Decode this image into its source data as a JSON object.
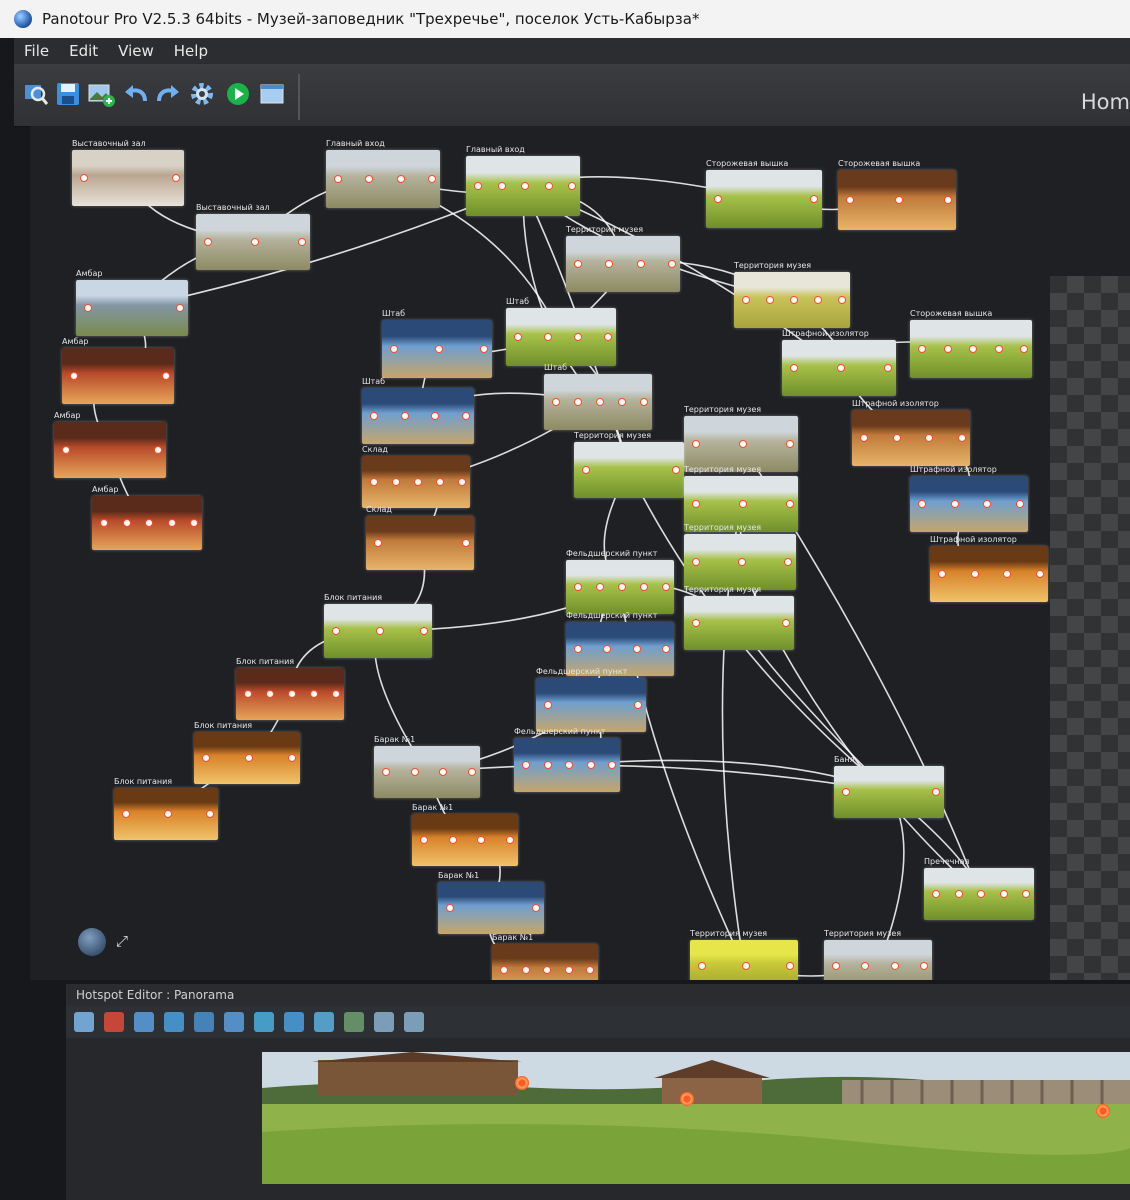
{
  "window": {
    "title": "Panotour Pro V2.5.3 64bits - Музей-заповедник \"Трехречье\", поселок Усть-Кабырза*"
  },
  "menu": [
    "File",
    "Edit",
    "View",
    "Help"
  ],
  "toolbar": {
    "buttons": [
      {
        "icon": "search-icon"
      },
      {
        "icon": "save-icon"
      },
      {
        "icon": "add-panorama-icon"
      },
      {
        "icon": "undo-icon"
      },
      {
        "icon": "redo-icon"
      },
      {
        "icon": "gear-icon"
      },
      {
        "icon": "play-icon"
      },
      {
        "icon": "window-icon"
      }
    ],
    "home_label": "Hom"
  },
  "graph": {
    "nodes": [
      {
        "id": "n1",
        "title": "Выставочный зал",
        "palette": "interior-light"
      },
      {
        "id": "n2",
        "title": "Выставочный зал",
        "palette": "field-cloudy"
      },
      {
        "id": "n3",
        "title": "Главный вход",
        "palette": "field-cloudy"
      },
      {
        "id": "n4",
        "title": "Главный вход",
        "palette": "field-green"
      },
      {
        "id": "n5",
        "title": "Сторожевая вышка",
        "palette": "field-green"
      },
      {
        "id": "n6",
        "title": "Сторожевая вышка",
        "palette": "interior-wood"
      },
      {
        "id": "n7",
        "title": "Территория музея",
        "palette": "field-cloudy"
      },
      {
        "id": "n8",
        "title": "Территория музея",
        "palette": "field-yellow"
      },
      {
        "id": "n9",
        "title": "Амбар",
        "palette": "field-blue"
      },
      {
        "id": "n10",
        "title": "Штаб",
        "palette": "interior-blue"
      },
      {
        "id": "n11",
        "title": "Штаб",
        "palette": "field-green"
      },
      {
        "id": "n12",
        "title": "Сторожевая вышка",
        "palette": "field-green"
      },
      {
        "id": "n13",
        "title": "Амбар",
        "palette": "interior-red"
      },
      {
        "id": "n14",
        "title": "Штрафной изолятор",
        "palette": "field-green"
      },
      {
        "id": "n15",
        "title": "Штаб",
        "palette": "interior-blue"
      },
      {
        "id": "n16",
        "title": "Штаб",
        "palette": "field-cloudy"
      },
      {
        "id": "n17",
        "title": "Амбар",
        "palette": "interior-red"
      },
      {
        "id": "n18",
        "title": "Территория музея",
        "palette": "field-cloudy"
      },
      {
        "id": "n19",
        "title": "Штрафной изолятор",
        "palette": "interior-wood"
      },
      {
        "id": "n20",
        "title": "Склад",
        "palette": "interior-wood"
      },
      {
        "id": "n21",
        "title": "Территория музея",
        "palette": "field-green"
      },
      {
        "id": "n22",
        "title": "Территория музея",
        "palette": "field-green"
      },
      {
        "id": "n23",
        "title": "Штрафной изолятор",
        "palette": "interior-blue"
      },
      {
        "id": "n24",
        "title": "Амбар",
        "palette": "interior-red"
      },
      {
        "id": "n25",
        "title": "Склад",
        "palette": "interior-wood"
      },
      {
        "id": "n26",
        "title": "Территория музея",
        "palette": "field-green"
      },
      {
        "id": "n27",
        "title": "Штрафной изолятор",
        "palette": "interior-orange"
      },
      {
        "id": "n28",
        "title": "Фельдшерский пункт",
        "palette": "field-green"
      },
      {
        "id": "n29",
        "title": "Территория музея",
        "palette": "field-green"
      },
      {
        "id": "n30",
        "title": "Блок питания",
        "palette": "field-green"
      },
      {
        "id": "n31",
        "title": "Фельдшерский пункт",
        "palette": "interior-blue"
      },
      {
        "id": "n32",
        "title": "Блок питания",
        "palette": "interior-red"
      },
      {
        "id": "n33",
        "title": "Фельдшерский пункт",
        "palette": "interior-blue"
      },
      {
        "id": "n34",
        "title": "Блок питания",
        "palette": "interior-orange"
      },
      {
        "id": "n35",
        "title": "Барак №1",
        "palette": "field-cloudy"
      },
      {
        "id": "n36",
        "title": "Фельдшерский пункт",
        "palette": "interior-blue"
      },
      {
        "id": "n37",
        "title": "Баня",
        "palette": "field-green"
      },
      {
        "id": "n38",
        "title": "Блок питания",
        "palette": "interior-orange"
      },
      {
        "id": "n39",
        "title": "Барак №1",
        "palette": "interior-orange"
      },
      {
        "id": "n40",
        "title": "Пречечная",
        "palette": "field-green"
      },
      {
        "id": "n41",
        "title": "Барак №1",
        "palette": "interior-blue"
      },
      {
        "id": "n42",
        "title": "Территория музея",
        "palette": "field-yellow-bright"
      },
      {
        "id": "n43",
        "title": "Территория музея",
        "palette": "field-cloudy"
      },
      {
        "id": "n44",
        "title": "Барак №1",
        "palette": "interior-wood"
      }
    ]
  },
  "palettes": {
    "interior-light": [
      "#d8d1c6",
      "#b9a690",
      "#e9e3da"
    ],
    "field-cloudy": [
      "#cfd6db",
      "#b4b39c",
      "#8d8a63"
    ],
    "field-green": [
      "#dfe4e7",
      "#a7c24a",
      "#6f8f2a"
    ],
    "interior-wood": [
      "#6a3a1c",
      "#c07a3a",
      "#e7b56a"
    ],
    "field-yellow": [
      "#e7e6d9",
      "#c9c35a",
      "#a8a33a"
    ],
    "field-blue": [
      "#c9d6e4",
      "#8496a3",
      "#7a8a4c"
    ],
    "interior-blue": [
      "#2b4a78",
      "#6f9fd0",
      "#c7a56a"
    ],
    "interior-red": [
      "#5a2a1a",
      "#b84a2a",
      "#e7a55a"
    ],
    "interior-orange": [
      "#6a3a14",
      "#d8822a",
      "#f0c46a"
    ],
    "field-yellow-bright": [
      "#e6e64a",
      "#c8c83a",
      "#9aa02a"
    ]
  },
  "hotspot_editor": {
    "title": "Hotspot Editor : Panorama",
    "tools": [
      "move-icon",
      "select-icon",
      "polygon-icon",
      "photo-hotspot-icon",
      "video-hotspot-icon",
      "text-hotspot-icon",
      "zoom-icon",
      "point-icon",
      "add-point-icon",
      "image-icon",
      "picture-icon",
      "picture-add-icon"
    ]
  },
  "colors": {
    "accent_hotspot": "#ff4a2a",
    "link_line": "#ffffff",
    "canvas_bg": "#1f2024"
  }
}
